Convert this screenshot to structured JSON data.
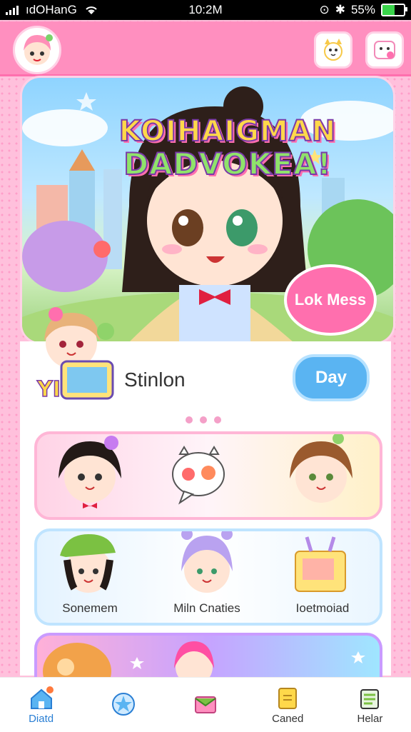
{
  "status_bar": {
    "carrier": "ıdOHanG",
    "time": "10:2M",
    "battery": "55%"
  },
  "header": {
    "avatar_icon": "anime-girl-avatar-icon",
    "right_icons": [
      "sticker-cat-icon",
      "sticker-face-icon"
    ]
  },
  "hero": {
    "title_line1": "KOIHAIGMAN",
    "title_line2": "DADVOKEA!",
    "bubble_text": "Lok Mess"
  },
  "profile": {
    "badge_text": "YI",
    "name": "Stinlon",
    "action_button": "Day"
  },
  "pager": {
    "count": 3
  },
  "cards": {
    "row1": {
      "middle_icon": "speech-bubble-food-icon"
    },
    "row2": {
      "labels": [
        "Sonemem",
        "Miln Cnaties",
        "Ioetmoiad"
      ]
    }
  },
  "tabbar": {
    "tabs": [
      {
        "label": "Diatd",
        "icon": "home-icon",
        "active": true
      },
      {
        "label": "",
        "icon": "star-rocket-icon"
      },
      {
        "label": "",
        "icon": "envelope-icon"
      },
      {
        "label": "Caned",
        "icon": "note-icon"
      },
      {
        "label": "Helar",
        "icon": "list-icon"
      }
    ]
  },
  "colors": {
    "accent": "#ff8fbf",
    "blue": "#5ab4f2",
    "pink": "#ff6fae"
  }
}
